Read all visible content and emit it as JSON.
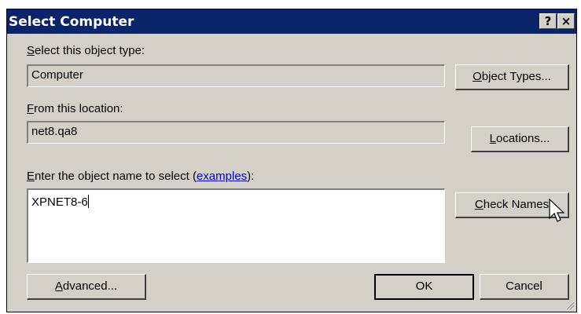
{
  "titlebar": {
    "title": "Select Computer",
    "help_label": "?",
    "close_label": "×"
  },
  "object_type": {
    "label_prefix": "",
    "label_accel": "S",
    "label_rest": "elect this object type:",
    "value": "Computer",
    "button_accel": "O",
    "button_rest": "bject Types..."
  },
  "location": {
    "label_accel": "E",
    "label_rest": "rom this location:",
    "label_full_first": "F",
    "value": "net8.qa8",
    "button_accel": "L",
    "button_rest": "ocations..."
  },
  "object_name": {
    "label_accel": "E",
    "label_rest": "nter the object name to select (",
    "link": "examples",
    "label_end": "):",
    "value": "XPNET8-6",
    "check_accel": "C",
    "check_rest": "heck Names"
  },
  "footer": {
    "advanced_accel": "A",
    "advanced_rest": "dvanced...",
    "ok_label": "OK",
    "cancel_label": "Cancel"
  },
  "colors": {
    "titlebar": "#0a246a",
    "dialog": "#d4d0c8",
    "link": "#0000cc"
  }
}
